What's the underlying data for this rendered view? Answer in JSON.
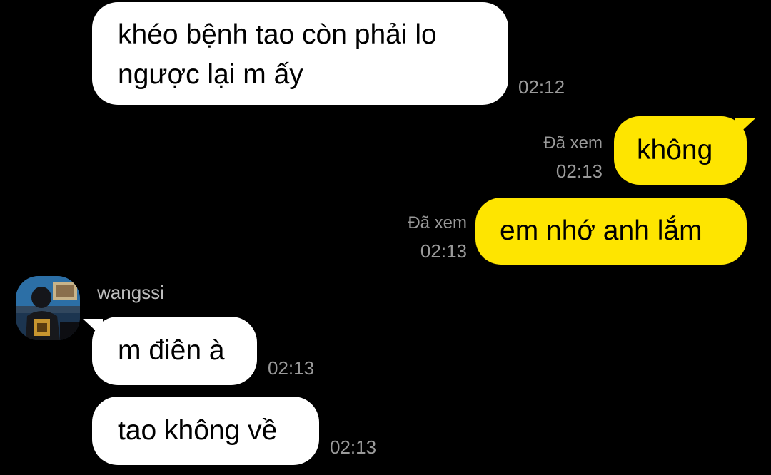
{
  "messages": [
    {
      "direction": "incoming",
      "lines": [
        "khéo bệnh tao còn phải lo",
        "ngược lại m ấy"
      ],
      "time": "02:12"
    },
    {
      "direction": "outgoing",
      "text": "không",
      "status": "Đã xem",
      "time": "02:13"
    },
    {
      "direction": "outgoing",
      "text": "em nhớ anh lắm",
      "status": "Đã xem",
      "time": "02:13"
    },
    {
      "direction": "incoming",
      "text": "m điên à",
      "time": "02:13"
    },
    {
      "direction": "incoming",
      "text": "tao không về",
      "time": "02:13"
    }
  ],
  "sender": {
    "name": "wangssi",
    "avatar": "user-avatar-image"
  },
  "colors": {
    "background": "#000000",
    "incoming_bubble": "#ffffff",
    "outgoing_bubble": "#fee500",
    "meta_text": "#9a9a9a",
    "sender_name": "#bdbdbd"
  }
}
